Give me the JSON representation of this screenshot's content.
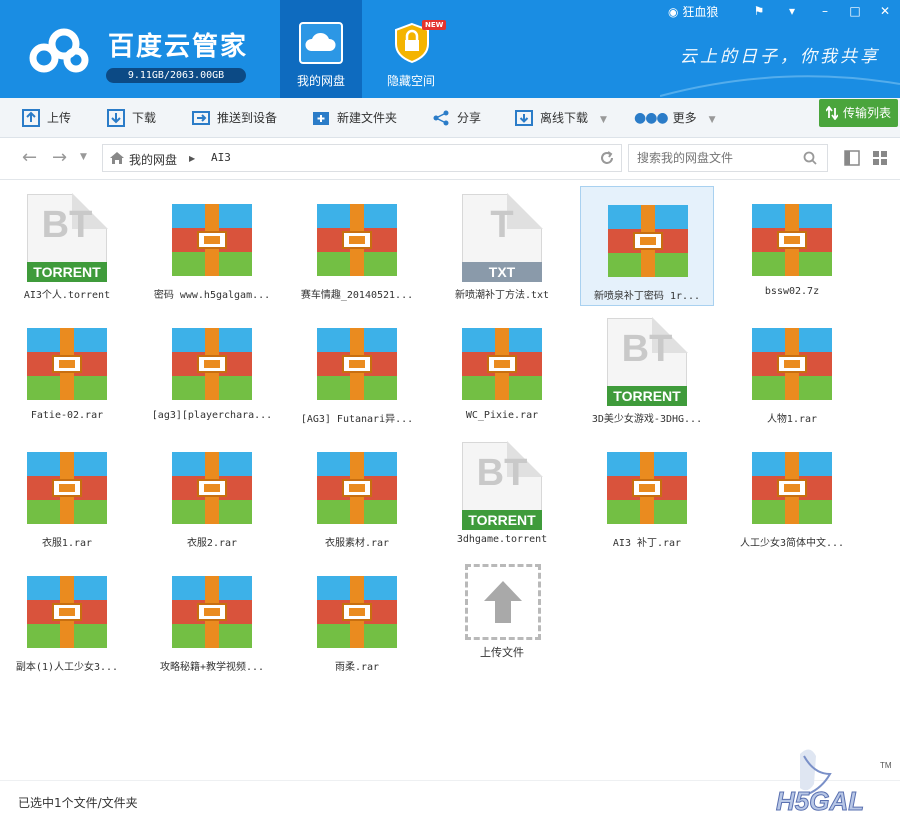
{
  "header": {
    "app_title": "百度云管家",
    "quota": "9.11GB/2063.00GB",
    "tabs": [
      {
        "label": "我的网盘"
      },
      {
        "label": "隐藏空间",
        "badge": "NEW"
      }
    ],
    "username": "狂血狼",
    "slogan": "云上的日子，你我共享",
    "window_buttons": [
      "⚑",
      "▾",
      "–",
      "□",
      "✕"
    ]
  },
  "toolbar": {
    "upload": "上传",
    "download": "下载",
    "push_to_device": "推送到设备",
    "new_folder": "新建文件夹",
    "share": "分享",
    "offline_download": "离线下载",
    "more": "更多",
    "transfer_list": "传输列表"
  },
  "address": {
    "crumbs": [
      "我的网盘",
      "AI3"
    ],
    "search_placeholder": "搜索我的网盘文件"
  },
  "files": [
    {
      "name": "AI3个人.torrent",
      "kind": "torrent"
    },
    {
      "name": "密码 www.h5galgam...",
      "kind": "rar"
    },
    {
      "name": "赛车情趣_20140521...",
      "kind": "rar"
    },
    {
      "name": "新喷潮补丁方法.txt",
      "kind": "txt"
    },
    {
      "name": "新喷泉补丁密码 1r...",
      "kind": "rar",
      "selected": true
    },
    {
      "name": "bssw02.7z",
      "kind": "rar"
    },
    {
      "name": "Fatie-02.rar",
      "kind": "rar"
    },
    {
      "name": "[ag3][playerchara...",
      "kind": "rar"
    },
    {
      "name": "[AG3] Futanari异...",
      "kind": "rar"
    },
    {
      "name": "WC_Pixie.rar",
      "kind": "rar"
    },
    {
      "name": "3D美少女游戏-3DHG...",
      "kind": "torrent"
    },
    {
      "name": "人物1.rar",
      "kind": "rar"
    },
    {
      "name": "衣服1.rar",
      "kind": "rar"
    },
    {
      "name": "衣服2.rar",
      "kind": "rar"
    },
    {
      "name": "衣服素材.rar",
      "kind": "rar"
    },
    {
      "name": "3dhgame.torrent",
      "kind": "torrent"
    },
    {
      "name": "AI3 补丁.rar",
      "kind": "rar"
    },
    {
      "name": "人工少女3简体中文...",
      "kind": "rar"
    },
    {
      "name": "副本(1)人工少女3...",
      "kind": "rar"
    },
    {
      "name": "攻略秘籍+教学视频...",
      "kind": "rar"
    },
    {
      "name": "雨柔.rar",
      "kind": "rar"
    }
  ],
  "icons": {
    "torrent_glyph": "BT",
    "torrent_band": "TORRENT",
    "txt_glyph": "T",
    "txt_band": "TXT"
  },
  "upload_tile_label": "上传文件",
  "status": "已选中1个文件/文件夹",
  "colors": {
    "header_bg": "#1a8de3",
    "active_tab": "#0e6bbf",
    "transfer_green": "#4aa53c",
    "selection_bg": "#e5f1fb"
  }
}
